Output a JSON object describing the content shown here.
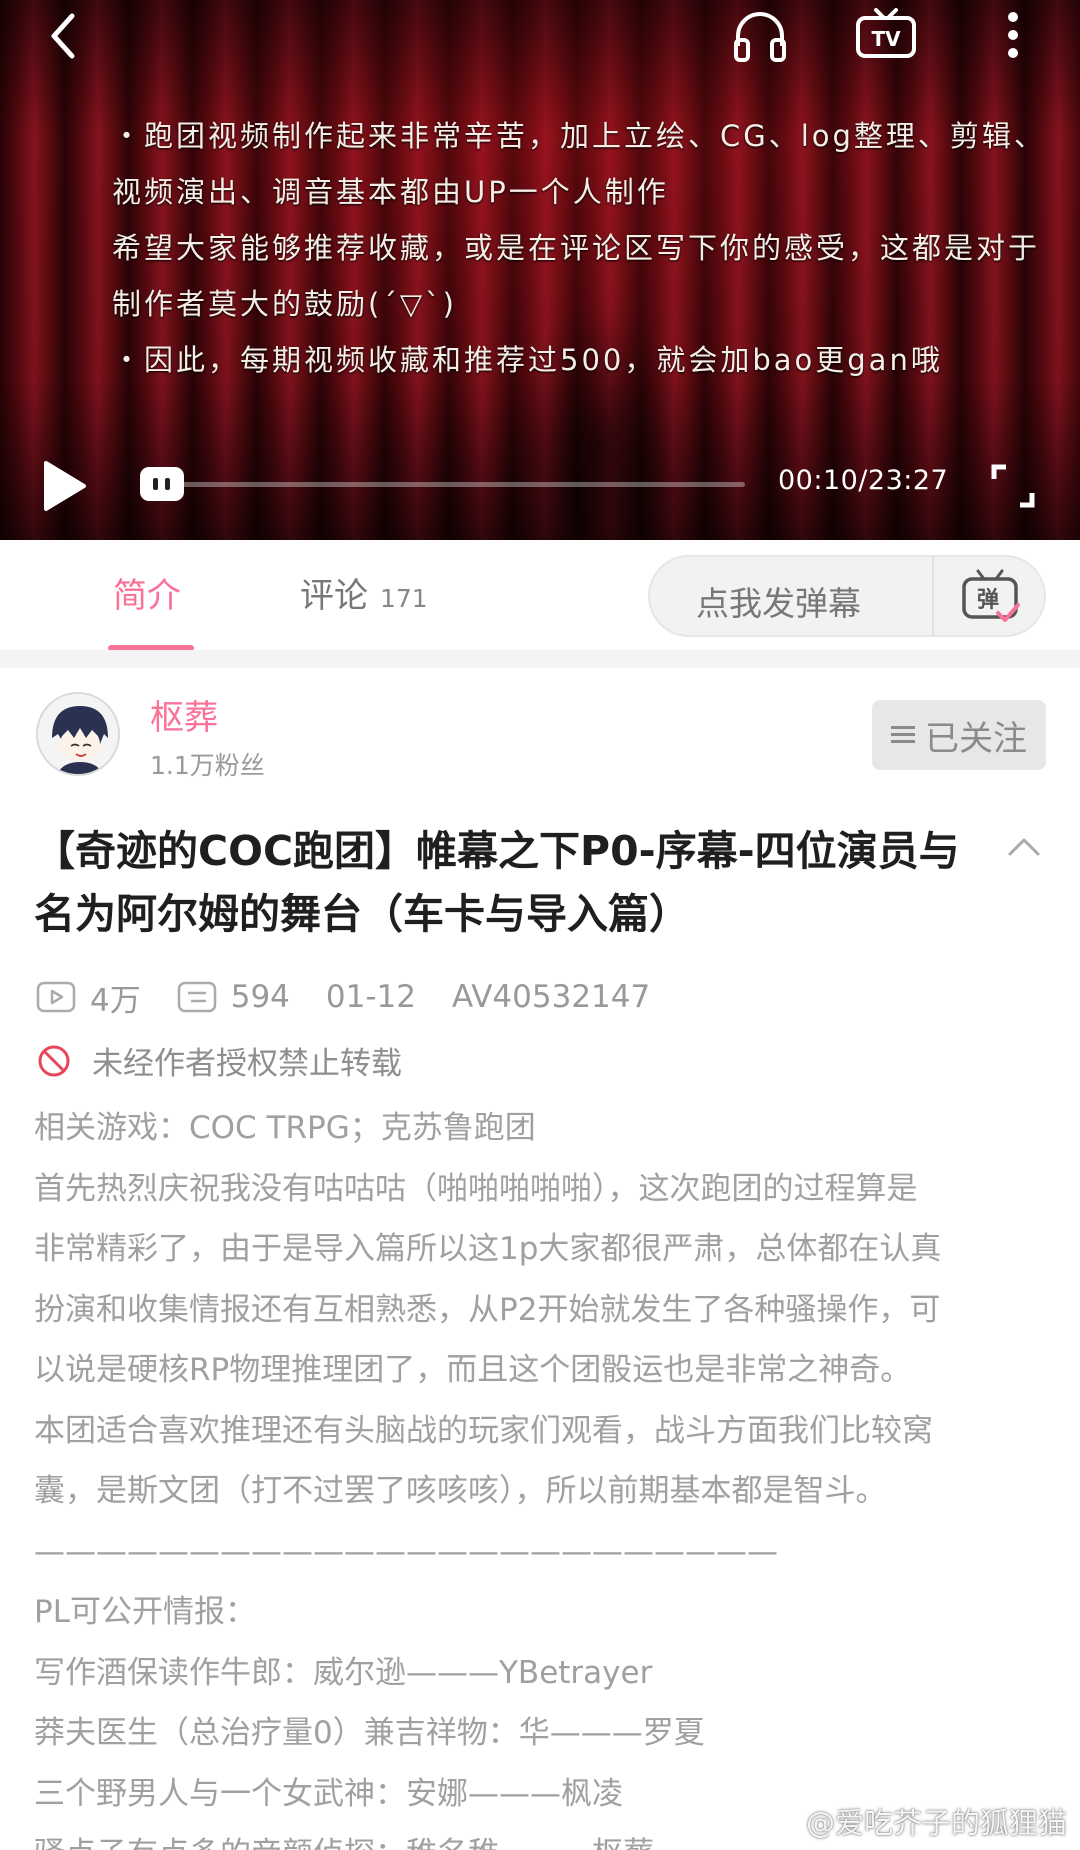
{
  "player": {
    "subtitle_lines": [
      "・跑团视频制作起来非常辛苦，加上立绘、CG、log整理、剪辑、",
      "视频演出、调音基本都由UP一个人制作",
      "希望大家能够推荐收藏，或是在评论区写下你的感受，这都是对于",
      "制作者莫大的鼓励(´▽`)",
      "・因此，每期视频收藏和推荐过500，就会加bao更gan哦"
    ],
    "time": "00:10/23:27",
    "progress": 0.007,
    "accent_color": "#fb7299"
  },
  "tabs": {
    "intro": "简介",
    "comments": "评论",
    "comment_count": "171",
    "danmaku_placeholder": "点我发弹幕"
  },
  "uploader": {
    "name": "枢葬",
    "fans": "1.1万粉丝",
    "follow_label": "已关注"
  },
  "video": {
    "title": "【奇迹的COC跑团】帷幕之下P0-序幕-四位演员与名为阿尔姆的舞台（车卡与导入篇）",
    "views": "4万",
    "danmaku_count": "594",
    "date": "01-12",
    "av": "AV40532147",
    "warning": "未经作者授权禁止转载"
  },
  "description": {
    "lines": [
      "相关游戏：COC  TRPG；克苏鲁跑团",
      "首先热烈庆祝我没有咕咕咕（啪啪啪啪啪），这次跑团的过程算是",
      "非常精彩了，由于是导入篇所以这1p大家都很严肃，总体都在认真",
      "扮演和收集情报还有互相熟悉，从P2开始就发生了各种骚操作，可",
      "以说是硬核RP物理推理团了，而且这个团骰运也是非常之神奇。",
      "本团适合喜欢推理还有头脑战的玩家们观看，战斗方面我们比较窝",
      "囊，是斯文团（打不过罢了咳咳咳），所以前期基本都是智斗。",
      "————————————————————————",
      "PL可公开情报：",
      "写作酒保读作牛郎：威尔逊———YBetrayer",
      "莽夫医生（总治疗量0）兼吉祥物：华———罗夏",
      "三个野男人与一个女武神：安娜———枫凌",
      "骚点子有点多的帝颜侦探：稚名稚———枢葬"
    ]
  },
  "watermark": "@爱吃芥子的狐狸猫"
}
